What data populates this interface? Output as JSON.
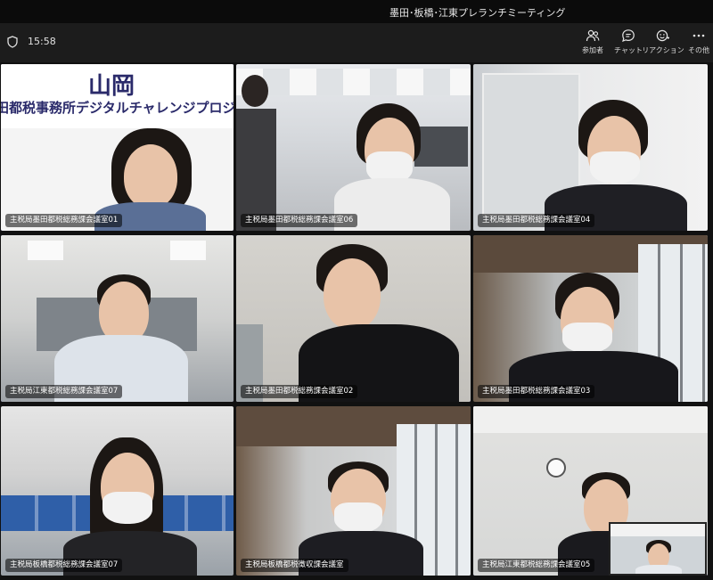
{
  "window": {
    "title": "墨田･板橋･江東プレランチミーティング"
  },
  "toolbar": {
    "timer": "15:58",
    "buttons": [
      {
        "id": "participants",
        "label": "参加者",
        "icon": "people-icon"
      },
      {
        "id": "chat",
        "label": "チャット",
        "icon": "chat-icon"
      },
      {
        "id": "reactions",
        "label": "リアクション",
        "icon": "reaction-icon"
      },
      {
        "id": "more",
        "label": "その他",
        "icon": "more-icon"
      }
    ]
  },
  "tiles": [
    {
      "name": "主税局墨田都税総務課会議室01",
      "active": true
    },
    {
      "name": "主税局墨田都税総務課会議室06",
      "active": false
    },
    {
      "name": "主税局墨田都税総務課会議室04",
      "active": false
    },
    {
      "name": "主税局江東都税総務課会議室07",
      "active": true
    },
    {
      "name": "主税局墨田都税総務課会議室02",
      "active": true
    },
    {
      "name": "主税局墨田都税総務課会議室03",
      "active": false
    },
    {
      "name": "主税局板橋都税総務課会議室07",
      "active": false
    },
    {
      "name": "主税局板橋都税徴収課会議室",
      "active": false
    },
    {
      "name": "主税局江東都税総務課会議室05",
      "active": true
    }
  ],
  "banner": {
    "line1": "山岡",
    "line2": "田都税事務所デジタルチャレンジプロジェ"
  },
  "colors": {
    "active_border": "#6f6fd8",
    "toolbar_bg": "#1c1c1c",
    "titlebar_bg": "#0b0b0b"
  }
}
